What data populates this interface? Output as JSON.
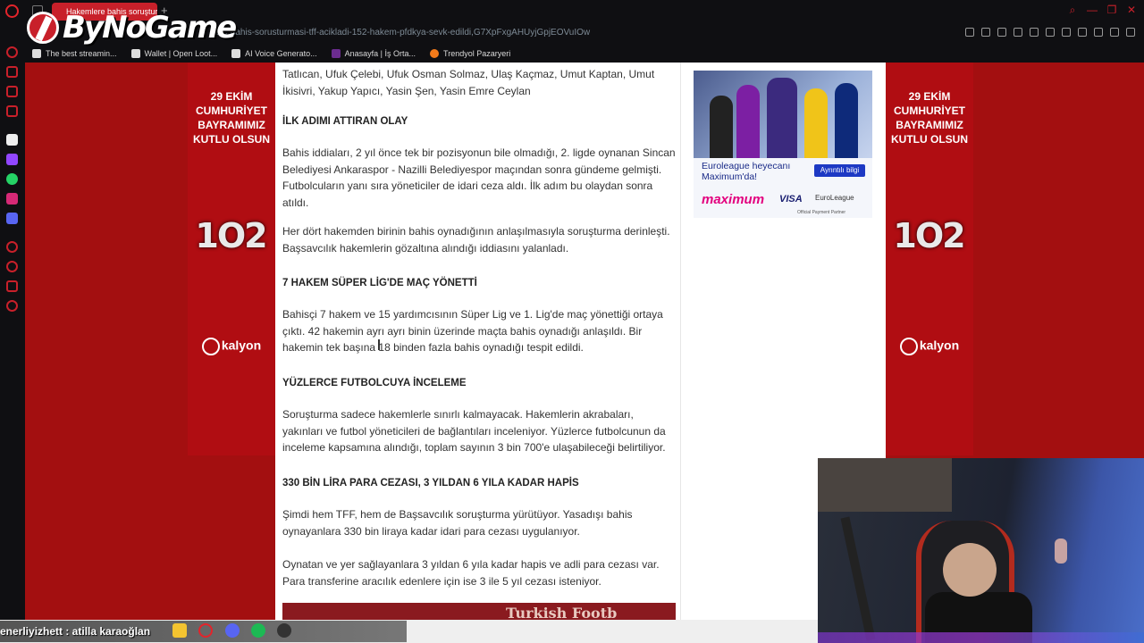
{
  "browser": {
    "tab_title": "Hakemlere bahis soruşturma",
    "new_tab": "+",
    "url": "ere-bahis-sorusturmasi-tff-acikladi-152-hakem-pfdkya-sevk-edildi,G7XpFxgAHUyjGpjEOVuIOw",
    "bookmarks": [
      {
        "label": "The best streamin..."
      },
      {
        "label": "Wallet | Open Loot..."
      },
      {
        "label": "AI Voice Generato..."
      },
      {
        "label": "Anasayfa | İş Orta..."
      },
      {
        "label": "Trendyol Pazaryeri"
      }
    ]
  },
  "watermark": {
    "text": "ByNoGame"
  },
  "side_ads": {
    "left": {
      "headline": "29 EKİM CUMHURİYET BAYRAMIMIZ KUTLU OLSUN",
      "emblem": "1O2",
      "brand": "kalyon"
    },
    "right": {
      "headline": "29 EKİM CUMHURİYET BAYRAMIMIZ KUTLU OLSUN",
      "emblem": "1O2",
      "brand": "kalyon"
    }
  },
  "article": {
    "p0": "Tatlıcan, Ufuk Çelebi, Ufuk Osman Solmaz, Ulaş Kaçmaz, Umut Kaptan, Umut İkisivri, Yakup Yapıcı, Yasin Şen, Yasin Emre Ceylan",
    "h1": "İLK ADIMI ATTIRAN OLAY",
    "p1": "Bahis iddiaları, 2 yıl önce tek bir pozisyonun bile olmadığı, 2. ligde oynanan Sincan Belediyesi Ankaraspor - Nazilli Belediyespor maçından sonra gündeme gelmişti. Futbolcuların yanı sıra yöneticiler de idari ceza aldı. İlk adım bu olaydan sonra atıldı.",
    "p2": "Her dört hakemden birinin bahis oynadığının anlaşılmasıyla soruşturma derinleşti. Başsavcılık hakemlerin gözaltına alındığı iddiasını yalanladı.",
    "h2": "7 HAKEM SÜPER LİG'DE MAÇ YÖNETTİ",
    "p3": "Bahisçi 7 hakem ve 15 yardımcısının Süper Lig ve 1. Lig'de maç yönettiği ortaya çıktı. 42 hakemin ayrı ayrı binin üzerinde maçta bahis oynadığı anlaşıldı. Bir hakemin tek başına 18 binden fazla bahis oynadığı tespit edildi.",
    "h3": "YÜZLERCE FUTBOLCUYA İNCELEME",
    "p4": "Soruşturma sadece hakemlerle sınırlı kalmayacak. Hakemlerin akrabaları, yakınları ve futbol yöneticileri de bağlantıları inceleniyor. Yüzlerce futbolcunun da inceleme kapsamına alındığı, toplam sayının 3 bin 700'e ulaşabileceği belirtiliyor.",
    "h4": "330 BİN LİRA PARA CEZASI, 3 YILDAN 6 YILA KADAR HAPİS",
    "p5": "Şimdi hem TFF, hem de Başsavcılık soruşturma yürütüyor. Yasadışı bahis oynayanlara 330 bin liraya kadar idari para cezası uygulanıyor.",
    "p6": "Oynatan ve yer sağlayanlara 3 yıldan 6 yıla kadar hapis ve adli para cezası var. Para transferine aracılık edenlere için ise 3 ile 5 yıl cezası isteniyor.",
    "image_caption": "Turkish Footb"
  },
  "promo": {
    "headline": "Euroleague heyecanı Maximum'da!",
    "button": "Ayrıntılı bilgi",
    "brand1": "maximum",
    "brand2": "VISA",
    "brand3": "EuroLeague",
    "brand3_sub": "Official Payment Partner"
  },
  "ticker": {
    "text": "enerliyizhett : atilla karaoğlan"
  },
  "colors": {
    "accent": "#c8202a",
    "ad_bg": "#b00d12"
  }
}
